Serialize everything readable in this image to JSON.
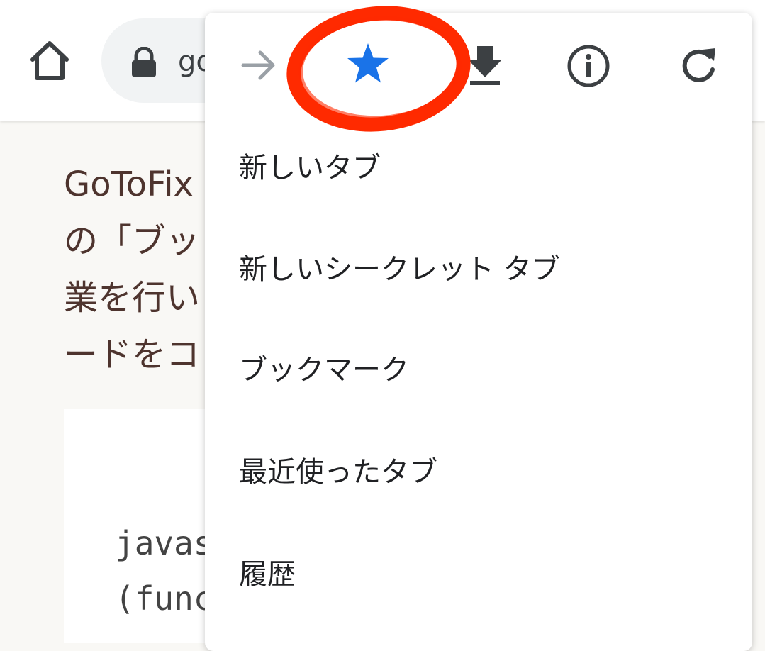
{
  "toolbar": {
    "url_partial": "go",
    "icons": [
      "home-icon",
      "lock-icon"
    ]
  },
  "page": {
    "paragraph_lines": [
      "GoToFix",
      "の「ブッ",
      "業を行い",
      "ードをコ"
    ],
    "code_lines": [
      "javas",
      "(func"
    ]
  },
  "menu": {
    "top_icons": [
      "forward-arrow-icon",
      "bookmark-star-icon",
      "download-icon",
      "info-icon",
      "refresh-icon"
    ],
    "items": [
      {
        "label": "新しいタブ"
      },
      {
        "label": "新しいシークレット タブ"
      },
      {
        "label": "ブックマーク"
      },
      {
        "label": "最近使ったタブ"
      },
      {
        "label": "履歴"
      }
    ]
  },
  "colors": {
    "star": "#1a73e8",
    "annotation": "#ff2a00",
    "text_dark": "#202124",
    "page_text": "#4e342e"
  }
}
